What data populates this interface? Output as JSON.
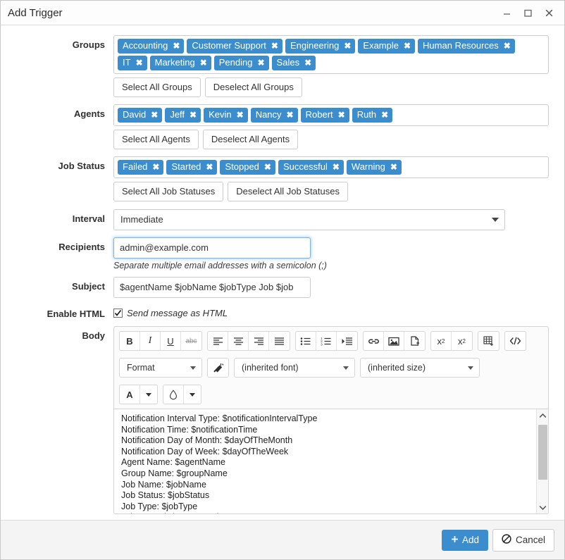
{
  "window": {
    "title": "Add Trigger",
    "controls": [
      {
        "name": "minimize",
        "glyph": "minimize-icon"
      },
      {
        "name": "maximize",
        "glyph": "maximize-icon"
      },
      {
        "name": "close",
        "glyph": "close-icon"
      }
    ]
  },
  "form": {
    "groups": {
      "label": "Groups",
      "tags": [
        "Accounting",
        "Customer Support",
        "Engineering",
        "Example",
        "Human Resources",
        "IT",
        "Marketing",
        "Pending",
        "Sales"
      ],
      "select_all": "Select All Groups",
      "deselect_all": "Deselect All Groups"
    },
    "agents": {
      "label": "Agents",
      "tags": [
        "David",
        "Jeff",
        "Kevin",
        "Nancy",
        "Robert",
        "Ruth"
      ],
      "select_all": "Select All Agents",
      "deselect_all": "Deselect All Agents"
    },
    "job_status": {
      "label": "Job Status",
      "tags": [
        "Failed",
        "Started",
        "Stopped",
        "Successful",
        "Warning"
      ],
      "select_all": "Select All Job Statuses",
      "deselect_all": "Deselect All Job Statuses"
    },
    "interval": {
      "label": "Interval",
      "value": "Immediate"
    },
    "recipients": {
      "label": "Recipients",
      "value": "admin@example.com",
      "hint": "Separate multiple email addresses with a semicolon (;)"
    },
    "subject": {
      "label": "Subject",
      "value": "$agentName $jobName $jobType Job $job"
    },
    "enable_html": {
      "label": "Enable HTML",
      "checkbox_label": "Send message as HTML",
      "checked": true
    },
    "body": {
      "label": "Body",
      "toolbar": {
        "groups": [
          [
            {
              "name": "bold-icon",
              "text": "B"
            },
            {
              "name": "italic-icon",
              "text": "I"
            },
            {
              "name": "underline-icon",
              "text": "U"
            },
            {
              "name": "strikethrough-icon",
              "text": "abc"
            }
          ],
          [
            {
              "name": "align-left-icon",
              "text": ""
            },
            {
              "name": "align-center-icon",
              "text": ""
            },
            {
              "name": "align-right-icon",
              "text": ""
            },
            {
              "name": "align-justify-icon",
              "text": ""
            }
          ],
          [
            {
              "name": "bulleted-list-icon",
              "text": ""
            },
            {
              "name": "numbered-list-icon",
              "text": ""
            },
            {
              "name": "indent-icon",
              "text": ""
            }
          ],
          [
            {
              "name": "link-icon",
              "text": ""
            },
            {
              "name": "image-icon",
              "text": ""
            },
            {
              "name": "page-break-icon",
              "text": ""
            }
          ],
          [
            {
              "name": "subscript-icon",
              "text": "x₂"
            },
            {
              "name": "superscript-icon",
              "text": "x²"
            }
          ],
          [
            {
              "name": "insert-table-icon",
              "text": ""
            }
          ],
          [
            {
              "name": "source-code-icon",
              "text": "</>"
            }
          ]
        ],
        "format_select": "Format",
        "remove_format_icon": "remove-format-icon",
        "font_select": "(inherited font)",
        "size_select": "(inherited size)",
        "text_color": "A",
        "background_color_icon": "droplet-icon"
      },
      "text": "Notification Interval Type: $notificationIntervalType\nNotification Time: $notificationTime\nNotification Day of Month: $dayOfTheMonth\nNotification Day of Week: $dayOfTheWeek\nAgent Name: $agentName\nGroup Name: $groupName\nJob Name: $jobName\nJob Status: $jobStatus\nJob Type: $jobType\nJob Started: $startDateTime"
    }
  },
  "footer": {
    "add_label": "Add",
    "add_icon": "plus-icon",
    "cancel_label": "Cancel",
    "cancel_icon": "ban-icon"
  },
  "colors": {
    "accent": "#3b8dce",
    "tag_bg": "#3b8dce",
    "footer_bg": "#f4f4f4",
    "border": "#cccccc"
  }
}
